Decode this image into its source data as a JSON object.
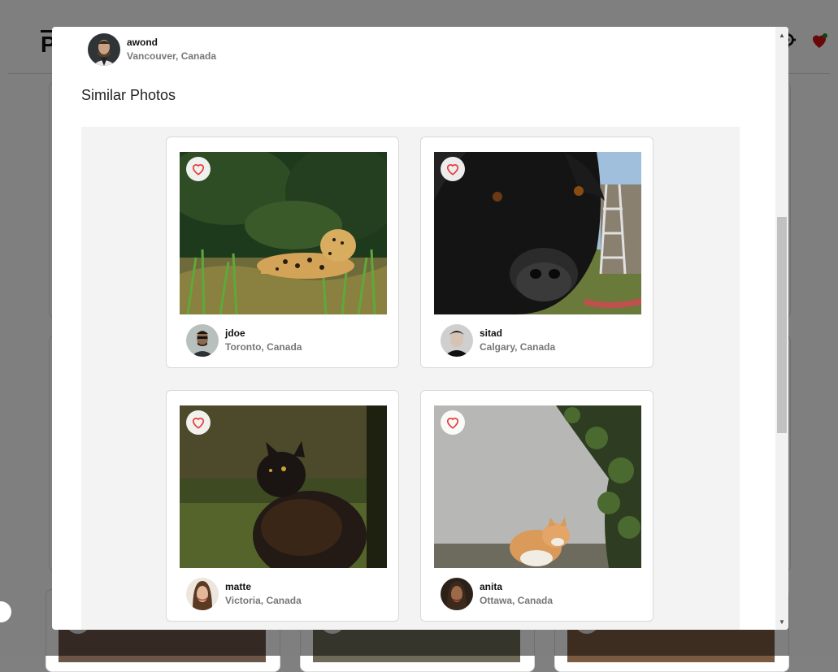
{
  "background": {
    "logo_text": "Ph",
    "icons": [
      "gear-icon",
      "heart-icon"
    ]
  },
  "modal": {
    "author": {
      "username": "awond",
      "location": "Vancouver, Canada"
    },
    "similar_title": "Similar Photos",
    "photos": [
      {
        "username": "jdoe",
        "location": "Toronto, Canada",
        "subject": "jaguar resting in grass"
      },
      {
        "username": "sitad",
        "location": "Calgary, Canada",
        "subject": "black dog close-up"
      },
      {
        "username": "matte",
        "location": "Victoria, Canada",
        "subject": "fluffy dark cat looking up"
      },
      {
        "username": "anita",
        "location": "Ottawa, Canada",
        "subject": "orange and white cat by wall"
      }
    ]
  },
  "colors": {
    "like_icon": "#e53935",
    "overlay": "rgba(0,0,0,0.5)"
  }
}
